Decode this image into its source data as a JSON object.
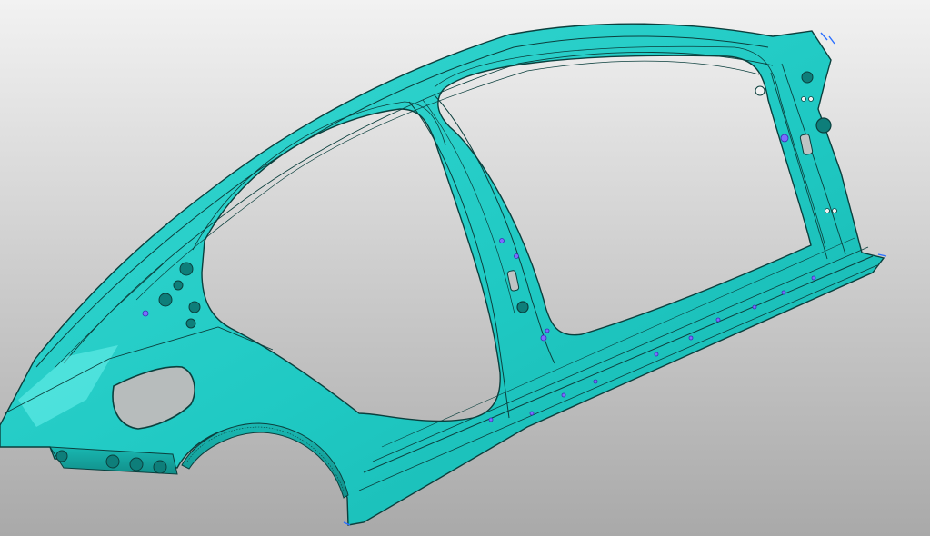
{
  "viewport": {
    "background": {
      "top_color": "#f2f2f2",
      "bottom_color": "#a9a9a9"
    }
  },
  "model": {
    "name": "body-side-outer-panel",
    "surface_color": "#1fc9c3",
    "edge_color": "#0b3f3d",
    "highlight_color": "#6ef2ec",
    "marker_color": "#7b6cff",
    "icons": [
      "pin-marker-icon"
    ]
  }
}
